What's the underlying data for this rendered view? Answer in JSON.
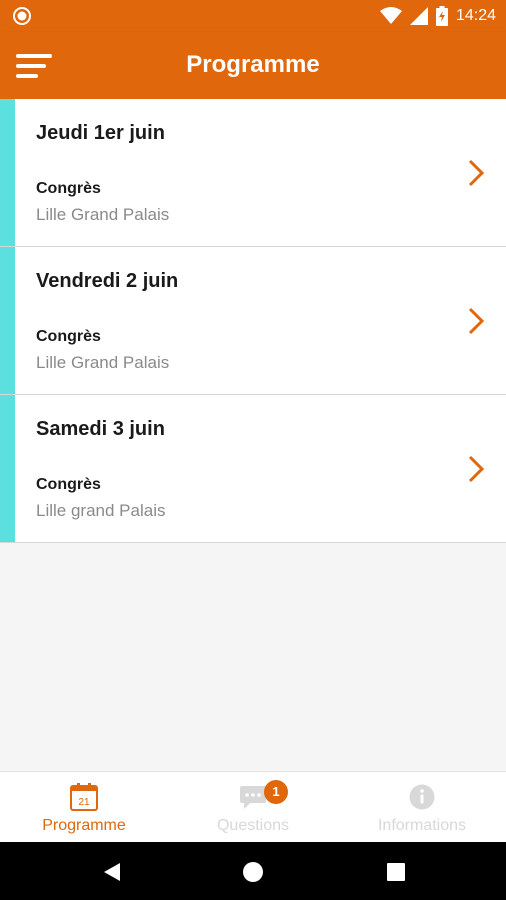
{
  "status_bar": {
    "time": "14:24"
  },
  "app_bar": {
    "title": "Programme"
  },
  "events": [
    {
      "day": "Jeudi 1er juin",
      "type": "Congrès",
      "place": "Lille Grand Palais"
    },
    {
      "day": "Vendredi 2 juin",
      "type": "Congrès",
      "place": "Lille Grand Palais"
    },
    {
      "day": "Samedi 3 juin",
      "type": "Congrès",
      "place": "Lille grand Palais"
    }
  ],
  "bottom_nav": {
    "programme": {
      "label": "Programme",
      "icon_text": "21"
    },
    "questions": {
      "label": "Questions",
      "badge": "1"
    },
    "informations": {
      "label": "Informations"
    }
  },
  "colors": {
    "brand": "#e0670b",
    "accent": "#5ce0df",
    "muted": "#8a8a8a"
  },
  "icons": [
    "notification-icon",
    "wifi-icon",
    "signal-icon",
    "battery-icon",
    "menu-icon",
    "chevron-right-icon",
    "calendar-icon",
    "chat-icon",
    "info-icon",
    "back-icon",
    "home-icon",
    "recents-icon"
  ]
}
